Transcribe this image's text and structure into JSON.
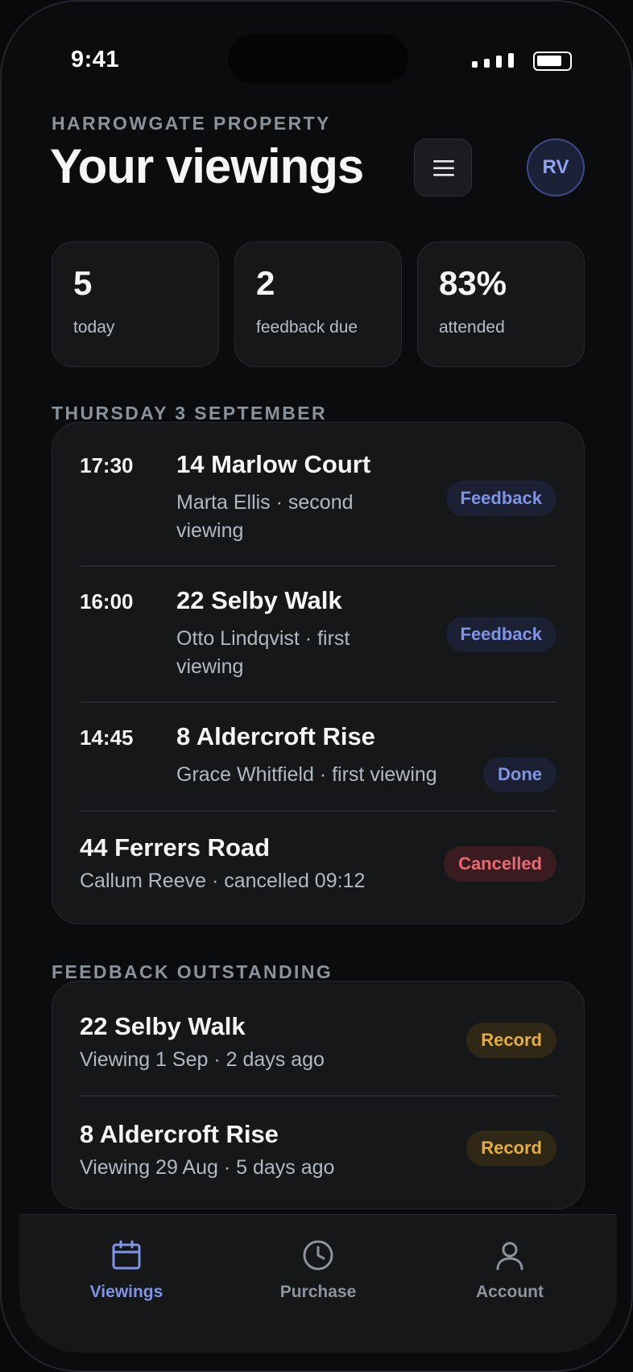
{
  "status_bar": {
    "time": "9:41"
  },
  "header": {
    "eyebrow": "HARROWGATE PROPERTY",
    "title": "Your viewings",
    "avatar_initials": "RV",
    "menu_icon": "hamburger-menu-icon"
  },
  "stats": [
    {
      "value": "5",
      "label": "today"
    },
    {
      "value": "2",
      "label": "feedback due"
    },
    {
      "value": "83%",
      "label": "attended"
    }
  ],
  "schedule": {
    "day_label": "THURSDAY 3 SEPTEMBER",
    "items": [
      {
        "time": "17:30",
        "address": "14 Marlow Court",
        "subtitle_line1": "Marta Ellis · second",
        "subtitle_line2": "viewing",
        "status": "Feedback"
      },
      {
        "time": "16:00",
        "address": "22 Selby Walk",
        "subtitle_line1": "Otto Lindqvist · first",
        "subtitle_line2": "viewing",
        "status": "Feedback"
      },
      {
        "time": "14:45",
        "address": "8 Aldercroft Rise",
        "subtitle_line1": "Grace Whitfield · first viewing",
        "status": "Done"
      },
      {
        "address": "44 Ferrers Road",
        "subtitle_line1": "Callum Reeve · cancelled 09:12",
        "status": "Cancelled"
      }
    ]
  },
  "feedback": {
    "section_label": "FEEDBACK OUTSTANDING",
    "items": [
      {
        "address": "22 Selby Walk",
        "subtitle": "Viewing 1 Sep · 2 days ago",
        "action": "Record"
      },
      {
        "address": "8 Aldercroft Rise",
        "subtitle": "Viewing 29 Aug · 5 days ago",
        "action": "Record"
      }
    ]
  },
  "tab_bar": {
    "active": "Viewings",
    "tabs": [
      {
        "label": "Viewings",
        "icon": "calendar-icon"
      },
      {
        "label": "Purchase",
        "icon": "clock-icon"
      },
      {
        "label": "Account",
        "icon": "user-icon"
      }
    ]
  },
  "colors": {
    "accent": "#7f94e6",
    "cancelled": "#e66a72",
    "record": "#e5ad3e",
    "background": "#0b0c0e",
    "card": "#151719"
  }
}
